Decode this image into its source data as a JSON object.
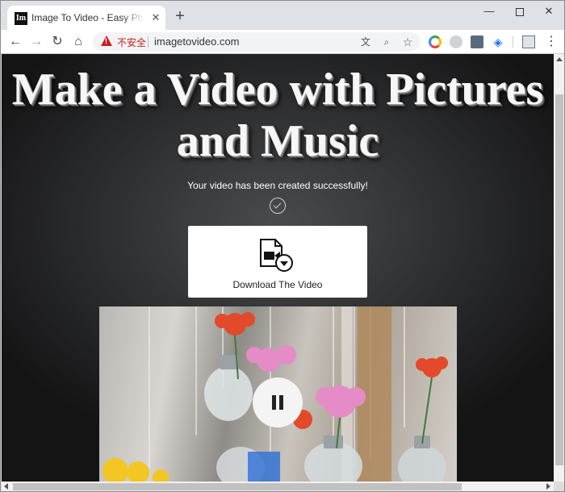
{
  "browser": {
    "tab": {
      "favicon_text": "Im",
      "title": "Image To Video - Easy Photo to Video Maker",
      "close_glyph": "✕"
    },
    "new_tab_glyph": "+",
    "window_controls": {
      "minimize": "—",
      "close": "✕"
    },
    "nav": {
      "back": "←",
      "forward": "→",
      "reload": "↻",
      "home": "⌂"
    },
    "omnibox": {
      "security_label": "不安全",
      "url": "imagetovideo.com",
      "translate_glyph": "文",
      "zoom_glyph": "⌕",
      "star_glyph": "☆"
    },
    "extensions": {
      "layers_glyph": "◈"
    },
    "menu_glyph": "⋮"
  },
  "page": {
    "headline_line1": "Make a Video with Pictures",
    "headline_line2": "and Music",
    "status_text": "Your video has been created successfully!",
    "download_label": "Download The Video"
  },
  "colors": {
    "insecure_red": "#c5221f",
    "page_background": "#2c2d2f",
    "headline_text": "#f6f6f6"
  },
  "icons": {
    "check": "check-circle-icon",
    "download": "video-file-download-icon",
    "pause": "pause-icon"
  }
}
